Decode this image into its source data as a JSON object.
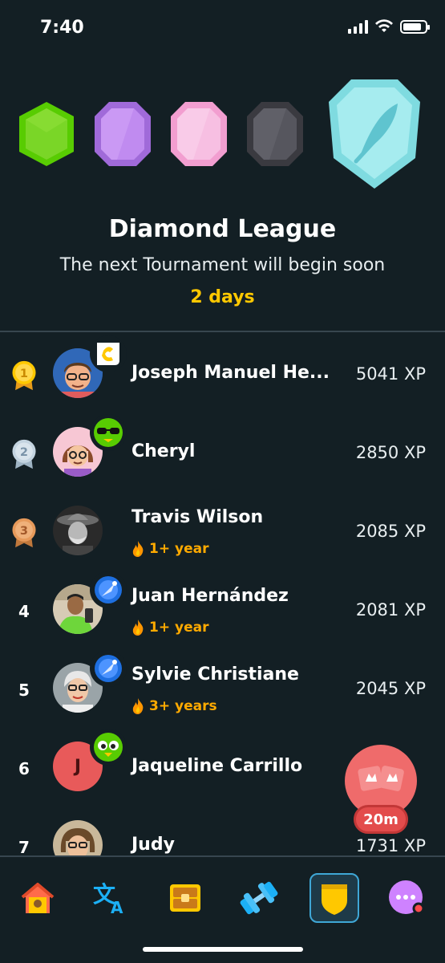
{
  "status_bar": {
    "time": "7:40"
  },
  "league": {
    "title": "Diamond League",
    "subtitle": "The next Tournament will begin soon",
    "countdown": "2 days",
    "badges": [
      "green-league-badge",
      "purple-league-badge",
      "pink-league-badge",
      "black-league-badge",
      "diamond-league-badge"
    ]
  },
  "leaderboard": [
    {
      "rank": "1",
      "rank_style": "gold-medal",
      "name": "Joseph Manuel He...",
      "xp": "5041 XP",
      "streak": ""
    },
    {
      "rank": "2",
      "rank_style": "silver-medal",
      "name": "Cheryl",
      "xp": "2850 XP",
      "streak": ""
    },
    {
      "rank": "3",
      "rank_style": "bronze-medal",
      "name": "Travis Wilson",
      "xp": "2085 XP",
      "streak": "1+ year"
    },
    {
      "rank": "4",
      "rank_style": "number",
      "name": "Juan Hernández",
      "xp": "2081 XP",
      "streak": "1+ year"
    },
    {
      "rank": "5",
      "rank_style": "number",
      "name": "Sylvie Christiane",
      "xp": "2045 XP",
      "streak": "3+ years"
    },
    {
      "rank": "6",
      "rank_style": "number",
      "name": "Jaqueline Carrillo",
      "xp": "",
      "streak": "",
      "avatar_letter": "J"
    },
    {
      "rank": "7",
      "rank_style": "number",
      "name": "Judy",
      "xp": "1731 XP",
      "streak": ""
    }
  ],
  "timer": {
    "label": "20m"
  },
  "nav": {
    "items": [
      "home-icon",
      "translate-icon",
      "chest-icon",
      "dumbbell-icon",
      "shield-icon",
      "more-icon"
    ],
    "active": "shield-icon"
  },
  "colors": {
    "background": "#131f24",
    "accent_gold": "#ffc800",
    "streak_orange": "#ffaa00",
    "divider": "#37464f"
  }
}
